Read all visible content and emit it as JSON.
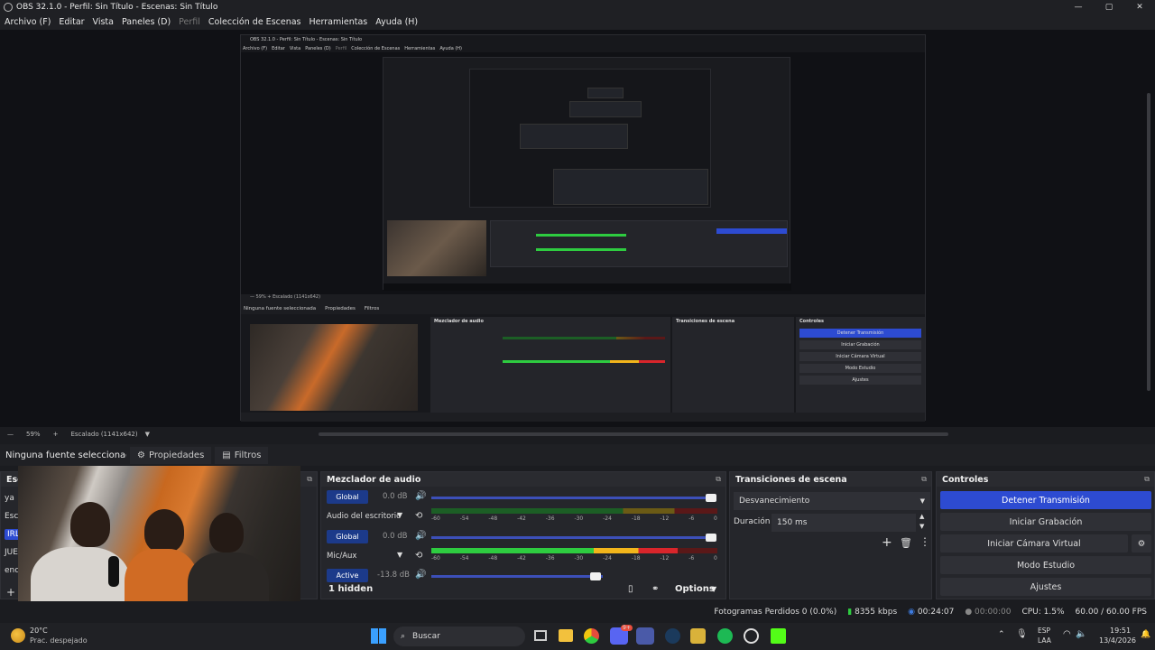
{
  "window": {
    "title": "OBS 32.1.0 - Perfil: Sin Título - Escenas: Sin Título",
    "minimize": "—",
    "maximize": "▢",
    "close": "✕"
  },
  "menu": [
    {
      "label": "Archivo (F)",
      "dim": false
    },
    {
      "label": "Editar",
      "dim": false
    },
    {
      "label": "Vista",
      "dim": false
    },
    {
      "label": "Paneles (D)",
      "dim": false
    },
    {
      "label": "Perfil",
      "dim": true
    },
    {
      "label": "Colección de Escenas",
      "dim": false
    },
    {
      "label": "Herramientas",
      "dim": false
    },
    {
      "label": "Ayuda (H)",
      "dim": false
    }
  ],
  "nested": {
    "title": "OBS 32.1.0 - Perfil: Sin Título - Escenas: Sin Título",
    "menu": [
      "Archivo (F)",
      "Editar",
      "Vista",
      "Paneles (D)",
      "Perfil",
      "Colección de Escenas",
      "Herramientas",
      "Ayuda (H)"
    ],
    "zoom_bar": "—   59%   +   Escalado (1141x642)",
    "no_source": "Ninguna fuente seleccionada",
    "properties": "Propiedades",
    "filters": "Filtros",
    "mixer_title": "Mezclador de audio",
    "trans_title": "Transiciones de escena",
    "ctrl_title": "Controles",
    "ctrl_buttons": [
      "Detener Transmisión",
      "Iniciar Grabación",
      "Iniciar Cámara Virtual",
      "Modo Estudio",
      "Ajustes"
    ],
    "status": "Fotogramas Perdidos 0 (0.0%)   8355 kbps   00:24:07   00:00:00   CPU: 1.5%   60.00 / 60.00 FPS"
  },
  "scale": {
    "minus": "—",
    "zoom": "59%",
    "plus": "+",
    "mode": "Escalado (1141x642)"
  },
  "source_bar": {
    "no_source": "Ninguna fuente seleccionada",
    "properties": "Propiedades",
    "filters": "Filtros"
  },
  "scenes": {
    "title": "Esc",
    "items": [
      "ya",
      "Esc",
      "IRL",
      "JUE",
      "enc"
    ],
    "selected_index": 2,
    "add": "+"
  },
  "mixer": {
    "title": "Mezclador de audio",
    "tracks": [
      {
        "badge": "Global",
        "db": "0.0 dB",
        "name": "Audio del escritorio",
        "volume": 1.0,
        "level": 0.0
      },
      {
        "badge": "Global",
        "db": "0.0 dB",
        "name": "Mic/Aux",
        "volume": 1.0,
        "level": 0.9
      },
      {
        "badge": "Active",
        "db": "-13.8 dB",
        "name": "",
        "volume": 0.57,
        "level": 0.0
      }
    ],
    "ticks": [
      "-60",
      "-54",
      "-48",
      "-42",
      "-36",
      "-30",
      "-24",
      "-18",
      "-12",
      "-6",
      "0"
    ],
    "hidden": "1 hidden",
    "options": "Options"
  },
  "transitions": {
    "title": "Transiciones de escena",
    "type": "Desvanecimiento",
    "duration_label": "Duración",
    "duration_value": "150 ms"
  },
  "controls": {
    "title": "Controles",
    "buttons": [
      "Detener Transmisión",
      "Iniciar Grabación",
      "Iniciar Cámara Virtual",
      "Modo Estudio",
      "Ajustes"
    ]
  },
  "status": {
    "dropped": "Fotogramas Perdidos 0 (0.0%)",
    "bitrate": "8355 kbps",
    "stream_time": "00:24:07",
    "rec_time": "00:00:00",
    "cpu": "CPU: 1.5%",
    "fps": "60.00 / 60.00 FPS"
  },
  "taskbar": {
    "weather_temp": "20°C",
    "weather_desc": "Prac. despejado",
    "search": "Buscar",
    "lang_top": "ESP",
    "lang_bottom": "LAA",
    "time": "19:51",
    "date": "13/4/2026",
    "discord_badge": "9+"
  },
  "colors": {
    "accent": "#2d4bd1",
    "meter_green": "#2ecc40",
    "meter_yellow": "#f2b51b",
    "meter_red": "#d9252b"
  }
}
